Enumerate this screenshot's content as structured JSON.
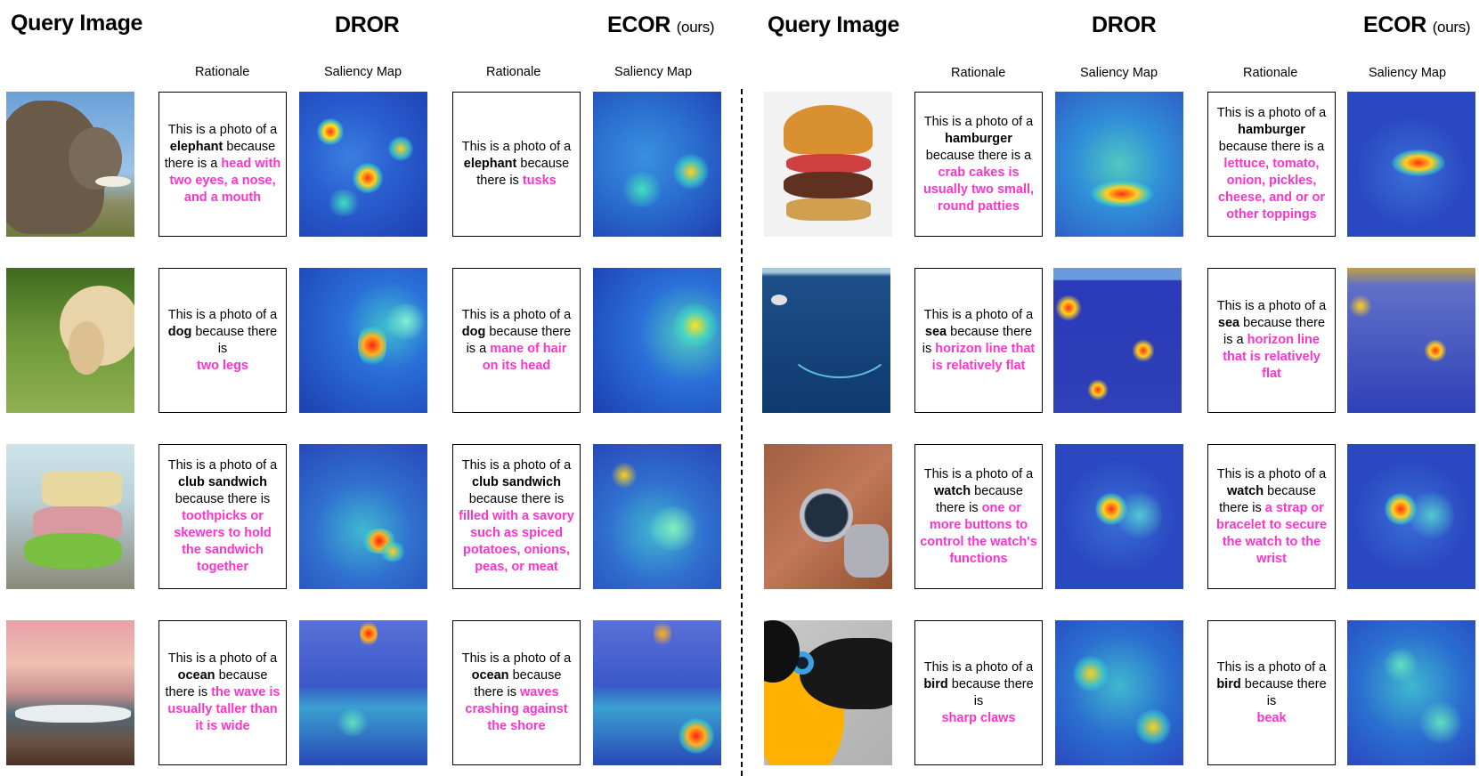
{
  "headers": {
    "query_image": "Query Image",
    "dror": "DROR",
    "ecor": "ECOR",
    "ecor_suffix": "(ours)",
    "rationale": "Rationale",
    "saliency_map": "Saliency Map"
  },
  "rows": [
    {
      "dror": {
        "pre": "This is a photo of a",
        "kw": "elephant",
        "mid": "because there is a",
        "reason": "head with two eyes, a nose, and a mouth"
      },
      "ecor": {
        "pre": "This is a photo of a",
        "kw": "elephant",
        "mid": "because there is",
        "reason": "tusks"
      }
    },
    {
      "dror": {
        "pre": "This is a photo of a",
        "kw": "dog",
        "mid": "because there is",
        "reason": "two legs"
      },
      "ecor": {
        "pre": "This is a photo of a",
        "kw": "dog",
        "mid": "because there is a",
        "reason": "mane of hair on its head"
      }
    },
    {
      "dror": {
        "pre": "This is a photo of a",
        "kw": "club sandwich",
        "mid": "because there is",
        "reason": "toothpicks or skewers to hold the sandwich together"
      },
      "ecor": {
        "pre": "This is a photo of a",
        "kw": "club sandwich",
        "mid": "because there is",
        "reason": "filled with a savory such as spiced potatoes, onions, peas, or meat"
      }
    },
    {
      "dror": {
        "pre": "This is a photo of a",
        "kw": "ocean",
        "mid": "because there is",
        "reason": "the wave is usually taller than it is wide"
      },
      "ecor": {
        "pre": "This is a photo of a",
        "kw": "ocean",
        "mid": "because there is",
        "reason": "waves crashing against the shore"
      }
    },
    {
      "dror": {
        "pre": "This is a photo of a",
        "kw": "hamburger",
        "mid": "because there is a",
        "reason": "crab cakes is usually two small, round patties"
      },
      "ecor": {
        "pre": "This is a photo of a",
        "kw": "hamburger",
        "mid": "because there is a",
        "reason": "lettuce, tomato, onion, pickles, cheese, and or or other toppings"
      }
    },
    {
      "dror": {
        "pre": "This is a photo of a",
        "kw": "sea",
        "mid": "because there is",
        "reason": "horizon line that is relatively flat"
      },
      "ecor": {
        "pre": "This is a photo of a",
        "kw": "sea",
        "mid": "because there is a",
        "reason": "horizon line that is relatively flat"
      }
    },
    {
      "dror": {
        "pre": "This is a photo of a",
        "kw": "watch",
        "mid": "because there is",
        "reason": "one or more buttons to control the watch's functions"
      },
      "ecor": {
        "pre": "This is a photo of a",
        "kw": "watch",
        "mid": "because there is",
        "reason": "a strap or bracelet to secure the watch to the wrist"
      }
    },
    {
      "dror": {
        "pre": "This is a photo of a",
        "kw": "bird",
        "mid": "because there is",
        "reason": "sharp claws"
      },
      "ecor": {
        "pre": "This is a photo of a",
        "kw": "bird",
        "mid": "because there is",
        "reason": "beak"
      }
    }
  ]
}
